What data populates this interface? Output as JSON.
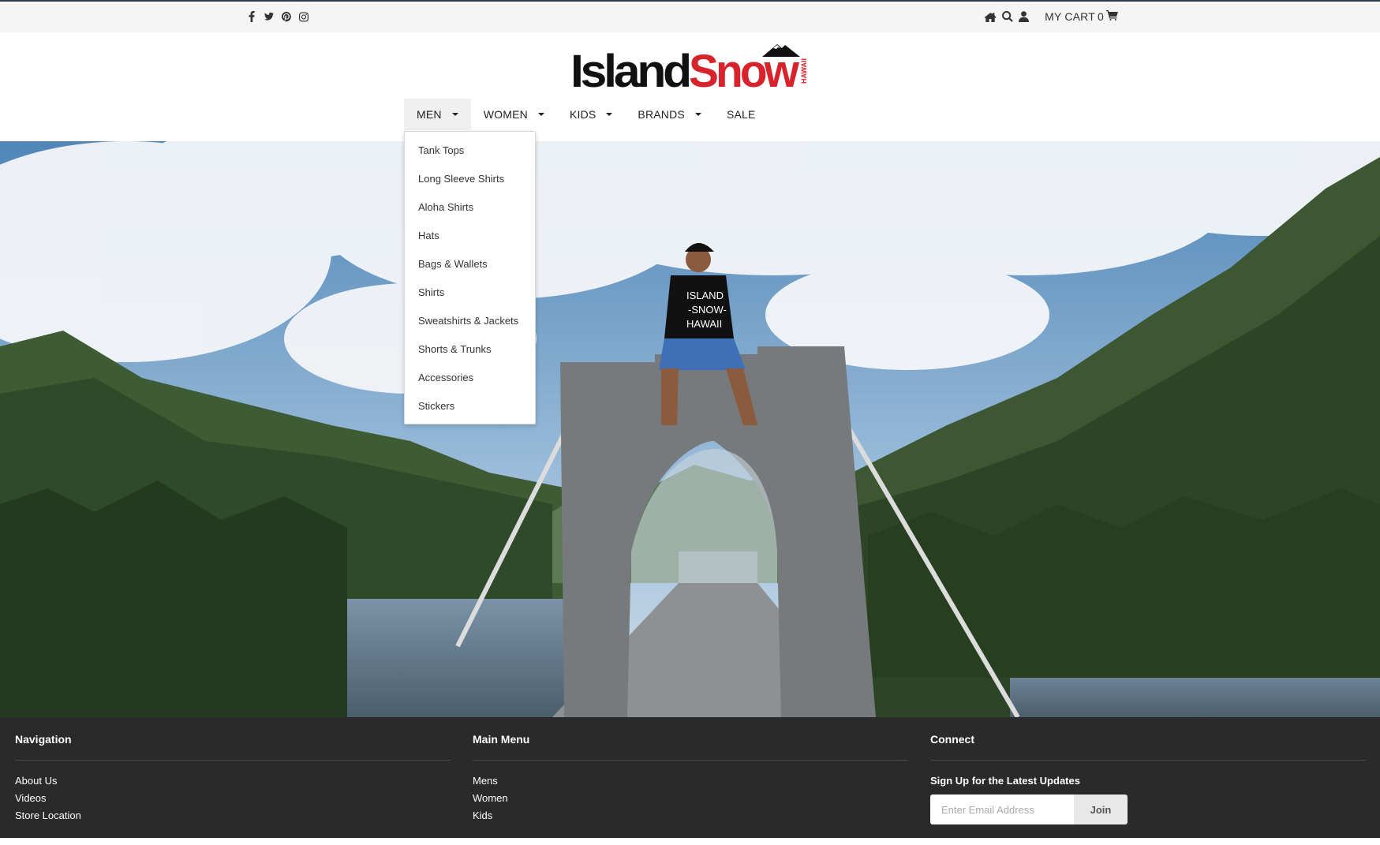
{
  "topbar": {
    "social_icons": [
      "facebook-icon",
      "twitter-icon",
      "pinterest-icon",
      "instagram-icon"
    ],
    "util_icons": [
      "home-icon",
      "search-icon",
      "user-icon"
    ],
    "cart_label": "MY CART",
    "cart_count": "0"
  },
  "logo": {
    "part1": "Island",
    "part2": "Snow",
    "tag": "HAWAII",
    "colors": {
      "black": "#111111",
      "red": "#d7232c"
    }
  },
  "nav": {
    "items": [
      {
        "label": "MEN",
        "has_caret": true,
        "active": true
      },
      {
        "label": "WOMEN",
        "has_caret": true,
        "active": false
      },
      {
        "label": "KIDS",
        "has_caret": true,
        "active": false
      },
      {
        "label": "BRANDS",
        "has_caret": true,
        "active": false
      },
      {
        "label": "SALE",
        "has_caret": false,
        "active": false
      }
    ],
    "men_dropdown": [
      "Tank Tops",
      "Long Sleeve Shirts",
      "Aloha Shirts",
      "Hats",
      "Bags & Wallets",
      "Shirts",
      "Sweatshirts & Jackets",
      "Shorts & Trunks",
      "Accessories",
      "Stickers"
    ]
  },
  "hero": {
    "shirt_text": [
      "ISLAND",
      "-SNOW-",
      "HAWAII"
    ]
  },
  "footer": {
    "navigation": {
      "title": "Navigation",
      "links": [
        "About Us",
        "Videos",
        "Store Location"
      ]
    },
    "main_menu": {
      "title": "Main Menu",
      "links": [
        "Mens",
        "Women",
        "Kids"
      ]
    },
    "connect": {
      "title": "Connect",
      "signup_label": "Sign Up for the Latest Updates",
      "email_placeholder": "Enter Email Address",
      "email_value": "",
      "join_label": "Join"
    },
    "background": "#2a2a2a"
  }
}
